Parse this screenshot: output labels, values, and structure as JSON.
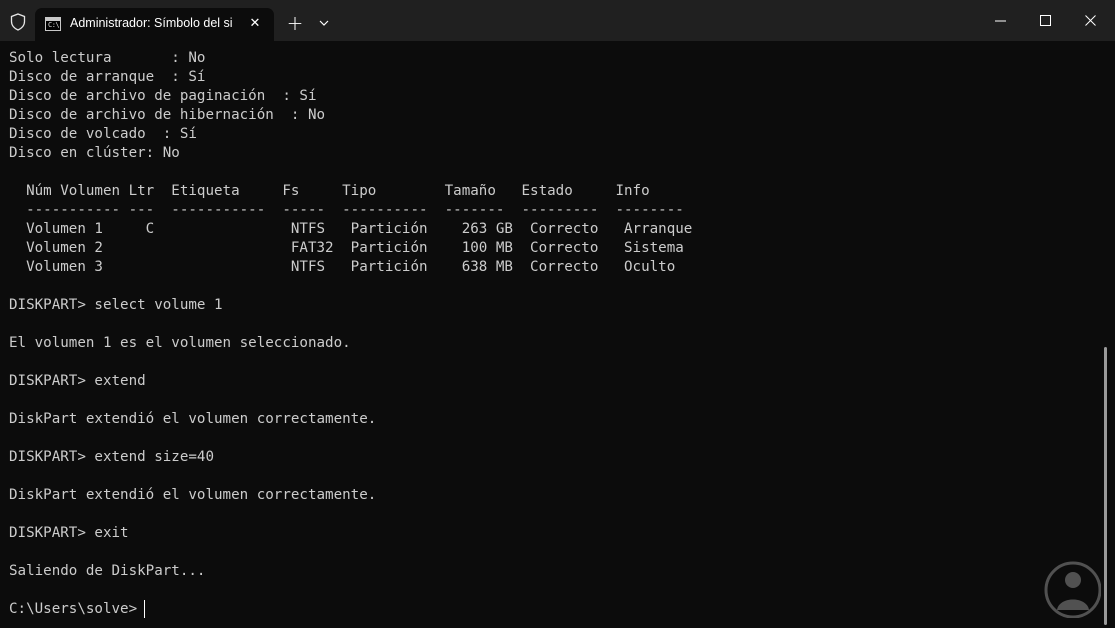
{
  "window": {
    "tab_title": "Administrador: Símbolo del si",
    "tab_icon_text": "C:\\",
    "close_glyph": "✕",
    "newtab_glyph": "+",
    "accent": "#0c0c0c",
    "titlebar_color": "#202020"
  },
  "terminal": {
    "lines": [
      "Solo lectura       : No",
      "Disco de arranque  : Sí",
      "Disco de archivo de paginación  : Sí",
      "Disco de archivo de hibernación  : No",
      "Disco de volcado  : Sí",
      "Disco en clúster: No",
      "",
      "  Núm Volumen Ltr  Etiqueta     Fs     Tipo        Tamaño   Estado     Info",
      "  ----------- ---  -----------  -----  ----------  -------  ---------  --------",
      "  Volumen 1     C                NTFS   Partición    263 GB  Correcto   Arranque",
      "  Volumen 2                      FAT32  Partición    100 MB  Correcto   Sistema",
      "  Volumen 3                      NTFS   Partición    638 MB  Correcto   Oculto",
      "",
      "DISKPART> select volume 1",
      "",
      "El volumen 1 es el volumen seleccionado.",
      "",
      "DISKPART> extend",
      "",
      "DiskPart extendió el volumen correctamente.",
      "",
      "DISKPART> extend size=40",
      "",
      "DiskPart extendió el volumen correctamente.",
      "",
      "DISKPART> exit",
      "",
      "Saliendo de DiskPart...",
      "",
      "C:\\Users\\solve>"
    ]
  },
  "icons": {
    "shield": "shield-icon",
    "tab": "cmd-icon",
    "dropdown": "chevron-down-icon",
    "minimize": "minimize-icon",
    "maximize": "maximize-icon",
    "close": "close-icon",
    "watermark": "logo-icon"
  }
}
